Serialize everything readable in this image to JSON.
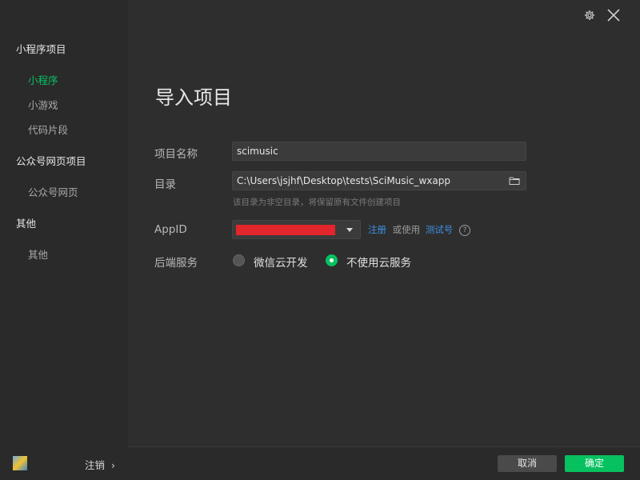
{
  "sidebar": {
    "groups": [
      {
        "title": "小程序项目",
        "items": [
          {
            "label": "小程序"
          },
          {
            "label": "小游戏"
          },
          {
            "label": "代码片段"
          }
        ]
      },
      {
        "title": "公众号网页项目",
        "items": [
          {
            "label": "公众号网页"
          }
        ]
      },
      {
        "title": "其他",
        "items": [
          {
            "label": "其他"
          }
        ]
      }
    ],
    "active_item": "小程序",
    "logout_label": "注销",
    "logout_chevron": "›"
  },
  "main": {
    "title": "导入项目",
    "fields": {
      "name": {
        "label": "项目名称",
        "value": "scimusic"
      },
      "dir": {
        "label": "目录",
        "value": "C:\\Users\\jsjhf\\Desktop\\tests\\SciMusic_wxapp",
        "hint": "该目录为非空目录，将保留原有文件创建项目"
      },
      "appid": {
        "label": "AppID",
        "value_redacted": true,
        "register_label": "注册",
        "or_use_label": "或使用",
        "test_account_label": "测试号",
        "help_glyph": "?"
      },
      "backend": {
        "label": "后端服务",
        "options": [
          {
            "label": "微信云开发",
            "selected": false
          },
          {
            "label": "不使用云服务",
            "selected": true
          }
        ]
      }
    }
  },
  "footer": {
    "cancel_label": "取消",
    "ok_label": "确定"
  },
  "icons": {
    "settings": "gear-icon",
    "close": "close-icon",
    "folder": "folder-icon",
    "help": "help-circle-icon",
    "dropdown": "chevron-down-icon"
  },
  "colors": {
    "accent": "#07c160",
    "link": "#3d8fe0",
    "redacted": "#e3262b"
  }
}
